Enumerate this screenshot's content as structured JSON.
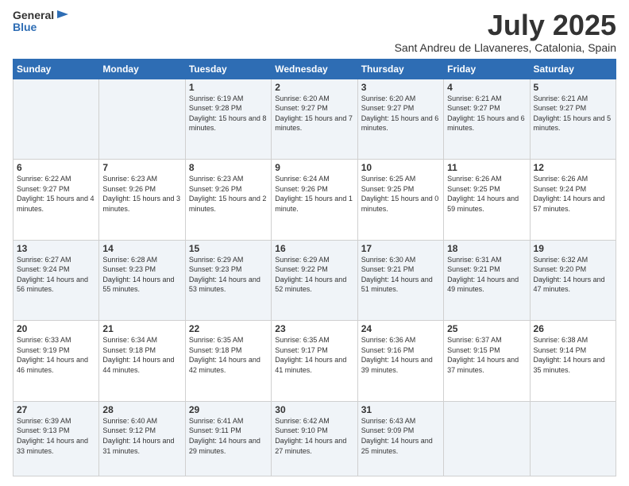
{
  "logo": {
    "general": "General",
    "blue": "Blue"
  },
  "title": {
    "month_year": "July 2025",
    "location": "Sant Andreu de Llavaneres, Catalonia, Spain"
  },
  "headers": [
    "Sunday",
    "Monday",
    "Tuesday",
    "Wednesday",
    "Thursday",
    "Friday",
    "Saturday"
  ],
  "weeks": [
    [
      {
        "day": "",
        "sunrise": "",
        "sunset": "",
        "daylight": ""
      },
      {
        "day": "",
        "sunrise": "",
        "sunset": "",
        "daylight": ""
      },
      {
        "day": "1",
        "sunrise": "Sunrise: 6:19 AM",
        "sunset": "Sunset: 9:28 PM",
        "daylight": "Daylight: 15 hours and 8 minutes."
      },
      {
        "day": "2",
        "sunrise": "Sunrise: 6:20 AM",
        "sunset": "Sunset: 9:27 PM",
        "daylight": "Daylight: 15 hours and 7 minutes."
      },
      {
        "day": "3",
        "sunrise": "Sunrise: 6:20 AM",
        "sunset": "Sunset: 9:27 PM",
        "daylight": "Daylight: 15 hours and 6 minutes."
      },
      {
        "day": "4",
        "sunrise": "Sunrise: 6:21 AM",
        "sunset": "Sunset: 9:27 PM",
        "daylight": "Daylight: 15 hours and 6 minutes."
      },
      {
        "day": "5",
        "sunrise": "Sunrise: 6:21 AM",
        "sunset": "Sunset: 9:27 PM",
        "daylight": "Daylight: 15 hours and 5 minutes."
      }
    ],
    [
      {
        "day": "6",
        "sunrise": "Sunrise: 6:22 AM",
        "sunset": "Sunset: 9:27 PM",
        "daylight": "Daylight: 15 hours and 4 minutes."
      },
      {
        "day": "7",
        "sunrise": "Sunrise: 6:23 AM",
        "sunset": "Sunset: 9:26 PM",
        "daylight": "Daylight: 15 hours and 3 minutes."
      },
      {
        "day": "8",
        "sunrise": "Sunrise: 6:23 AM",
        "sunset": "Sunset: 9:26 PM",
        "daylight": "Daylight: 15 hours and 2 minutes."
      },
      {
        "day": "9",
        "sunrise": "Sunrise: 6:24 AM",
        "sunset": "Sunset: 9:26 PM",
        "daylight": "Daylight: 15 hours and 1 minute."
      },
      {
        "day": "10",
        "sunrise": "Sunrise: 6:25 AM",
        "sunset": "Sunset: 9:25 PM",
        "daylight": "Daylight: 15 hours and 0 minutes."
      },
      {
        "day": "11",
        "sunrise": "Sunrise: 6:26 AM",
        "sunset": "Sunset: 9:25 PM",
        "daylight": "Daylight: 14 hours and 59 minutes."
      },
      {
        "day": "12",
        "sunrise": "Sunrise: 6:26 AM",
        "sunset": "Sunset: 9:24 PM",
        "daylight": "Daylight: 14 hours and 57 minutes."
      }
    ],
    [
      {
        "day": "13",
        "sunrise": "Sunrise: 6:27 AM",
        "sunset": "Sunset: 9:24 PM",
        "daylight": "Daylight: 14 hours and 56 minutes."
      },
      {
        "day": "14",
        "sunrise": "Sunrise: 6:28 AM",
        "sunset": "Sunset: 9:23 PM",
        "daylight": "Daylight: 14 hours and 55 minutes."
      },
      {
        "day": "15",
        "sunrise": "Sunrise: 6:29 AM",
        "sunset": "Sunset: 9:23 PM",
        "daylight": "Daylight: 14 hours and 53 minutes."
      },
      {
        "day": "16",
        "sunrise": "Sunrise: 6:29 AM",
        "sunset": "Sunset: 9:22 PM",
        "daylight": "Daylight: 14 hours and 52 minutes."
      },
      {
        "day": "17",
        "sunrise": "Sunrise: 6:30 AM",
        "sunset": "Sunset: 9:21 PM",
        "daylight": "Daylight: 14 hours and 51 minutes."
      },
      {
        "day": "18",
        "sunrise": "Sunrise: 6:31 AM",
        "sunset": "Sunset: 9:21 PM",
        "daylight": "Daylight: 14 hours and 49 minutes."
      },
      {
        "day": "19",
        "sunrise": "Sunrise: 6:32 AM",
        "sunset": "Sunset: 9:20 PM",
        "daylight": "Daylight: 14 hours and 47 minutes."
      }
    ],
    [
      {
        "day": "20",
        "sunrise": "Sunrise: 6:33 AM",
        "sunset": "Sunset: 9:19 PM",
        "daylight": "Daylight: 14 hours and 46 minutes."
      },
      {
        "day": "21",
        "sunrise": "Sunrise: 6:34 AM",
        "sunset": "Sunset: 9:18 PM",
        "daylight": "Daylight: 14 hours and 44 minutes."
      },
      {
        "day": "22",
        "sunrise": "Sunrise: 6:35 AM",
        "sunset": "Sunset: 9:18 PM",
        "daylight": "Daylight: 14 hours and 42 minutes."
      },
      {
        "day": "23",
        "sunrise": "Sunrise: 6:35 AM",
        "sunset": "Sunset: 9:17 PM",
        "daylight": "Daylight: 14 hours and 41 minutes."
      },
      {
        "day": "24",
        "sunrise": "Sunrise: 6:36 AM",
        "sunset": "Sunset: 9:16 PM",
        "daylight": "Daylight: 14 hours and 39 minutes."
      },
      {
        "day": "25",
        "sunrise": "Sunrise: 6:37 AM",
        "sunset": "Sunset: 9:15 PM",
        "daylight": "Daylight: 14 hours and 37 minutes."
      },
      {
        "day": "26",
        "sunrise": "Sunrise: 6:38 AM",
        "sunset": "Sunset: 9:14 PM",
        "daylight": "Daylight: 14 hours and 35 minutes."
      }
    ],
    [
      {
        "day": "27",
        "sunrise": "Sunrise: 6:39 AM",
        "sunset": "Sunset: 9:13 PM",
        "daylight": "Daylight: 14 hours and 33 minutes."
      },
      {
        "day": "28",
        "sunrise": "Sunrise: 6:40 AM",
        "sunset": "Sunset: 9:12 PM",
        "daylight": "Daylight: 14 hours and 31 minutes."
      },
      {
        "day": "29",
        "sunrise": "Sunrise: 6:41 AM",
        "sunset": "Sunset: 9:11 PM",
        "daylight": "Daylight: 14 hours and 29 minutes."
      },
      {
        "day": "30",
        "sunrise": "Sunrise: 6:42 AM",
        "sunset": "Sunset: 9:10 PM",
        "daylight": "Daylight: 14 hours and 27 minutes."
      },
      {
        "day": "31",
        "sunrise": "Sunrise: 6:43 AM",
        "sunset": "Sunset: 9:09 PM",
        "daylight": "Daylight: 14 hours and 25 minutes."
      },
      {
        "day": "",
        "sunrise": "",
        "sunset": "",
        "daylight": ""
      },
      {
        "day": "",
        "sunrise": "",
        "sunset": "",
        "daylight": ""
      }
    ]
  ]
}
